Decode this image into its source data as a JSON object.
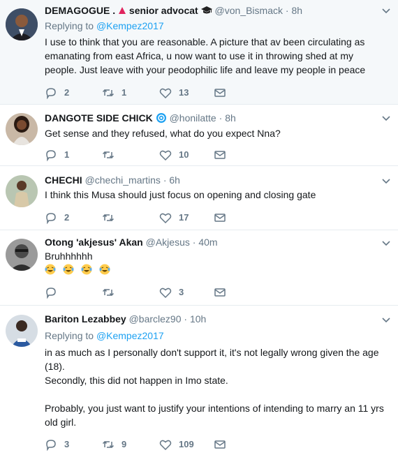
{
  "tweets": [
    {
      "name": "DEMAGOGUE .",
      "name_suffix": "senior advocat",
      "handle": "@von_Bismack",
      "time": "8h",
      "replying_prefix": "Replying to",
      "replying_to": "@Kempez2017",
      "text": "I use to think that you are reasonable. A picture that av been circulating as emanating from east Africa, u now want to use it in throwing shed at my people. Just leave with your peodophilic life and leave my people in peace",
      "replies": "2",
      "retweets": "1",
      "likes": "13"
    },
    {
      "name": "DANGOTE SIDE CHICK",
      "handle": "@honilatte",
      "time": "8h",
      "text": "Get sense and they refused, what do you expect Nna?",
      "replies": "1",
      "retweets": "",
      "likes": "10"
    },
    {
      "name": "CHECHI",
      "handle": "@chechi_martins",
      "time": "6h",
      "text": "I think this Musa should just focus on opening and closing gate",
      "replies": "2",
      "retweets": "",
      "likes": "17"
    },
    {
      "name": "Otong 'akjesus' Akan",
      "handle": "@Akjesus",
      "time": "40m",
      "text": "Bruhhhhhh",
      "emoji": [
        "laughing-tears",
        "laughing-tears",
        "laughing-tears",
        "laughing-tears"
      ],
      "replies": "",
      "retweets": "",
      "likes": "3"
    },
    {
      "name": "Bariton Lezabbey",
      "handle": "@barclez90",
      "time": "10h",
      "replying_prefix": "Replying to",
      "replying_to": "@Kempez2017",
      "lines": [
        "in as much as I personally don't support it, it's not legally wrong given the age (18).",
        "Secondly, this did not happen in Imo state.",
        "",
        "Probably, you just want to justify your intentions of intending to marry an 11 yrs old girl."
      ],
      "replies": "3",
      "retweets": "9",
      "likes": "109"
    }
  ],
  "colors": {
    "accent": "#1da1f2",
    "muted": "#657786",
    "highlight_bg": "#f5f8fa",
    "divider": "#e6ecf0"
  },
  "icons": [
    "reply-icon",
    "retweet-icon",
    "like-icon",
    "dm-icon",
    "chevron-down-icon",
    "verified-ring-icon",
    "graduation-cap-icon",
    "red-triangle-icon"
  ]
}
